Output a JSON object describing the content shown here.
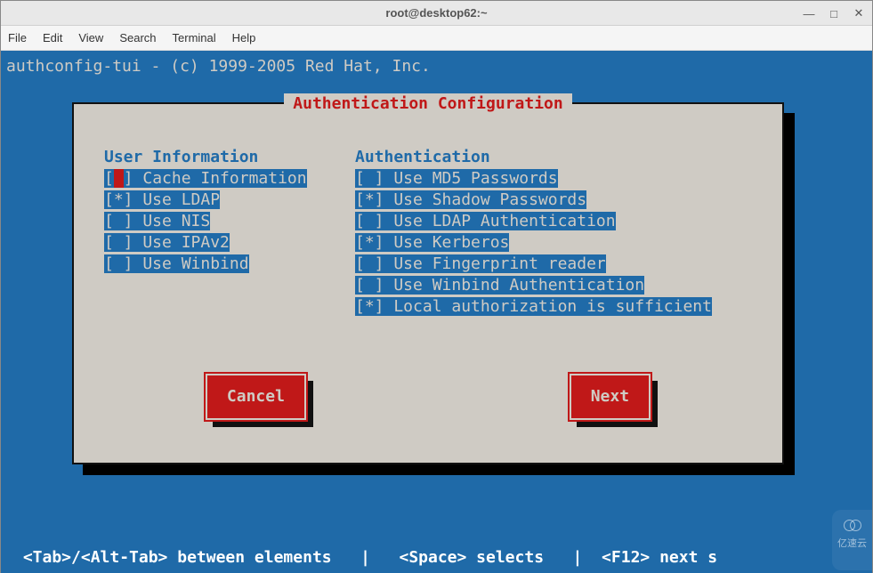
{
  "window": {
    "title": "root@desktop62:~",
    "min": "—",
    "max": "□",
    "close": "✕"
  },
  "menu": {
    "file": "File",
    "edit": "Edit",
    "view": "View",
    "search": "Search",
    "terminal": "Terminal",
    "help": "Help"
  },
  "header_line": "authconfig-tui - (c) 1999-2005 Red Hat, Inc.",
  "dialog": {
    "title": "Authentication Configuration",
    "left_header": "User Information",
    "right_header": "Authentication",
    "left_items": [
      {
        "checked": false,
        "label": "Cache Information",
        "focused": true
      },
      {
        "checked": true,
        "label": "Use LDAP"
      },
      {
        "checked": false,
        "label": "Use NIS"
      },
      {
        "checked": false,
        "label": "Use IPAv2"
      },
      {
        "checked": false,
        "label": "Use Winbind"
      }
    ],
    "right_items": [
      {
        "checked": false,
        "label": "Use MD5 Passwords"
      },
      {
        "checked": true,
        "label": "Use Shadow Passwords"
      },
      {
        "checked": false,
        "label": "Use LDAP Authentication"
      },
      {
        "checked": true,
        "label": "Use Kerberos"
      },
      {
        "checked": false,
        "label": "Use Fingerprint reader"
      },
      {
        "checked": false,
        "label": "Use Winbind Authentication"
      },
      {
        "checked": true,
        "label": "Local authorization is sufficient"
      }
    ],
    "cancel": "Cancel",
    "next": "Next"
  },
  "helpbar": " <Tab>/<Alt-Tab> between elements   |   <Space> selects   |  <F12> next s",
  "watermark": "亿速云"
}
